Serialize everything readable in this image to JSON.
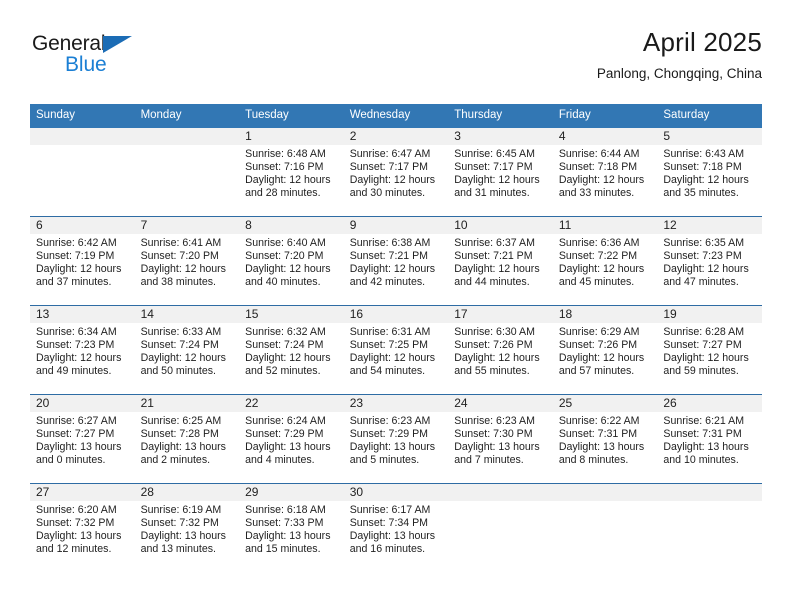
{
  "brand": {
    "name_dark": "General",
    "name_blue": "Blue",
    "accent_blue": "#1b7fd4",
    "triangle_blue": "#1b6cb5"
  },
  "header": {
    "title": "April 2025",
    "subtitle": "Panlong, Chongqing, China",
    "header_bg": "#3277b4",
    "row_divider": "#2e6ca4",
    "daynum_band_bg": "#f1f1f1"
  },
  "weekdays": [
    "Sunday",
    "Monday",
    "Tuesday",
    "Wednesday",
    "Thursday",
    "Friday",
    "Saturday"
  ],
  "labels": {
    "sunrise": "Sunrise:",
    "sunset": "Sunset:",
    "daylight": "Daylight:"
  },
  "weeks": [
    [
      {
        "blank": true
      },
      {
        "blank": true
      },
      {
        "day": "1",
        "sunrise": "Sunrise: 6:48 AM",
        "sunset": "Sunset: 7:16 PM",
        "daylight1": "Daylight: 12 hours",
        "daylight2": "and 28 minutes."
      },
      {
        "day": "2",
        "sunrise": "Sunrise: 6:47 AM",
        "sunset": "Sunset: 7:17 PM",
        "daylight1": "Daylight: 12 hours",
        "daylight2": "and 30 minutes."
      },
      {
        "day": "3",
        "sunrise": "Sunrise: 6:45 AM",
        "sunset": "Sunset: 7:17 PM",
        "daylight1": "Daylight: 12 hours",
        "daylight2": "and 31 minutes."
      },
      {
        "day": "4",
        "sunrise": "Sunrise: 6:44 AM",
        "sunset": "Sunset: 7:18 PM",
        "daylight1": "Daylight: 12 hours",
        "daylight2": "and 33 minutes."
      },
      {
        "day": "5",
        "sunrise": "Sunrise: 6:43 AM",
        "sunset": "Sunset: 7:18 PM",
        "daylight1": "Daylight: 12 hours",
        "daylight2": "and 35 minutes."
      }
    ],
    [
      {
        "day": "6",
        "sunrise": "Sunrise: 6:42 AM",
        "sunset": "Sunset: 7:19 PM",
        "daylight1": "Daylight: 12 hours",
        "daylight2": "and 37 minutes."
      },
      {
        "day": "7",
        "sunrise": "Sunrise: 6:41 AM",
        "sunset": "Sunset: 7:20 PM",
        "daylight1": "Daylight: 12 hours",
        "daylight2": "and 38 minutes."
      },
      {
        "day": "8",
        "sunrise": "Sunrise: 6:40 AM",
        "sunset": "Sunset: 7:20 PM",
        "daylight1": "Daylight: 12 hours",
        "daylight2": "and 40 minutes."
      },
      {
        "day": "9",
        "sunrise": "Sunrise: 6:38 AM",
        "sunset": "Sunset: 7:21 PM",
        "daylight1": "Daylight: 12 hours",
        "daylight2": "and 42 minutes."
      },
      {
        "day": "10",
        "sunrise": "Sunrise: 6:37 AM",
        "sunset": "Sunset: 7:21 PM",
        "daylight1": "Daylight: 12 hours",
        "daylight2": "and 44 minutes."
      },
      {
        "day": "11",
        "sunrise": "Sunrise: 6:36 AM",
        "sunset": "Sunset: 7:22 PM",
        "daylight1": "Daylight: 12 hours",
        "daylight2": "and 45 minutes."
      },
      {
        "day": "12",
        "sunrise": "Sunrise: 6:35 AM",
        "sunset": "Sunset: 7:23 PM",
        "daylight1": "Daylight: 12 hours",
        "daylight2": "and 47 minutes."
      }
    ],
    [
      {
        "day": "13",
        "sunrise": "Sunrise: 6:34 AM",
        "sunset": "Sunset: 7:23 PM",
        "daylight1": "Daylight: 12 hours",
        "daylight2": "and 49 minutes."
      },
      {
        "day": "14",
        "sunrise": "Sunrise: 6:33 AM",
        "sunset": "Sunset: 7:24 PM",
        "daylight1": "Daylight: 12 hours",
        "daylight2": "and 50 minutes."
      },
      {
        "day": "15",
        "sunrise": "Sunrise: 6:32 AM",
        "sunset": "Sunset: 7:24 PM",
        "daylight1": "Daylight: 12 hours",
        "daylight2": "and 52 minutes."
      },
      {
        "day": "16",
        "sunrise": "Sunrise: 6:31 AM",
        "sunset": "Sunset: 7:25 PM",
        "daylight1": "Daylight: 12 hours",
        "daylight2": "and 54 minutes."
      },
      {
        "day": "17",
        "sunrise": "Sunrise: 6:30 AM",
        "sunset": "Sunset: 7:26 PM",
        "daylight1": "Daylight: 12 hours",
        "daylight2": "and 55 minutes."
      },
      {
        "day": "18",
        "sunrise": "Sunrise: 6:29 AM",
        "sunset": "Sunset: 7:26 PM",
        "daylight1": "Daylight: 12 hours",
        "daylight2": "and 57 minutes."
      },
      {
        "day": "19",
        "sunrise": "Sunrise: 6:28 AM",
        "sunset": "Sunset: 7:27 PM",
        "daylight1": "Daylight: 12 hours",
        "daylight2": "and 59 minutes."
      }
    ],
    [
      {
        "day": "20",
        "sunrise": "Sunrise: 6:27 AM",
        "sunset": "Sunset: 7:27 PM",
        "daylight1": "Daylight: 13 hours",
        "daylight2": "and 0 minutes."
      },
      {
        "day": "21",
        "sunrise": "Sunrise: 6:25 AM",
        "sunset": "Sunset: 7:28 PM",
        "daylight1": "Daylight: 13 hours",
        "daylight2": "and 2 minutes."
      },
      {
        "day": "22",
        "sunrise": "Sunrise: 6:24 AM",
        "sunset": "Sunset: 7:29 PM",
        "daylight1": "Daylight: 13 hours",
        "daylight2": "and 4 minutes."
      },
      {
        "day": "23",
        "sunrise": "Sunrise: 6:23 AM",
        "sunset": "Sunset: 7:29 PM",
        "daylight1": "Daylight: 13 hours",
        "daylight2": "and 5 minutes."
      },
      {
        "day": "24",
        "sunrise": "Sunrise: 6:23 AM",
        "sunset": "Sunset: 7:30 PM",
        "daylight1": "Daylight: 13 hours",
        "daylight2": "and 7 minutes."
      },
      {
        "day": "25",
        "sunrise": "Sunrise: 6:22 AM",
        "sunset": "Sunset: 7:31 PM",
        "daylight1": "Daylight: 13 hours",
        "daylight2": "and 8 minutes."
      },
      {
        "day": "26",
        "sunrise": "Sunrise: 6:21 AM",
        "sunset": "Sunset: 7:31 PM",
        "daylight1": "Daylight: 13 hours",
        "daylight2": "and 10 minutes."
      }
    ],
    [
      {
        "day": "27",
        "sunrise": "Sunrise: 6:20 AM",
        "sunset": "Sunset: 7:32 PM",
        "daylight1": "Daylight: 13 hours",
        "daylight2": "and 12 minutes."
      },
      {
        "day": "28",
        "sunrise": "Sunrise: 6:19 AM",
        "sunset": "Sunset: 7:32 PM",
        "daylight1": "Daylight: 13 hours",
        "daylight2": "and 13 minutes."
      },
      {
        "day": "29",
        "sunrise": "Sunrise: 6:18 AM",
        "sunset": "Sunset: 7:33 PM",
        "daylight1": "Daylight: 13 hours",
        "daylight2": "and 15 minutes."
      },
      {
        "day": "30",
        "sunrise": "Sunrise: 6:17 AM",
        "sunset": "Sunset: 7:34 PM",
        "daylight1": "Daylight: 13 hours",
        "daylight2": "and 16 minutes."
      },
      {
        "blank": true
      },
      {
        "blank": true
      },
      {
        "blank": true
      }
    ]
  ]
}
